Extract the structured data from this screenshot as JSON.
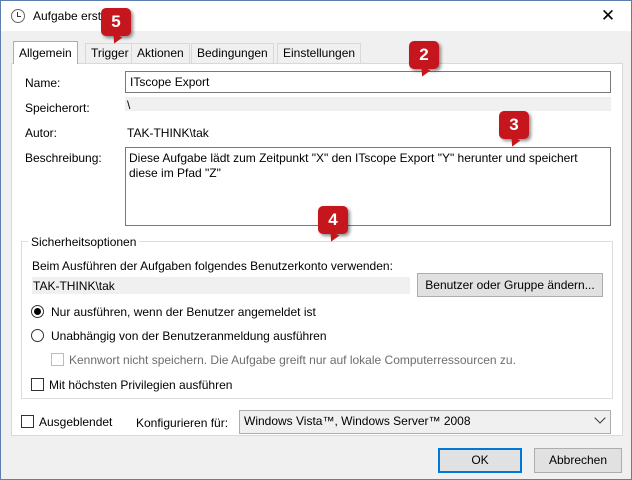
{
  "window": {
    "title": "Aufgabe erst",
    "close_glyph": "✕"
  },
  "tabs": [
    {
      "label": "Allgemein"
    },
    {
      "label": "Trigger"
    },
    {
      "label": "Aktionen"
    },
    {
      "label": "Bedingungen"
    },
    {
      "label": "Einstellungen"
    }
  ],
  "general": {
    "name_label": "Name:",
    "name_value": "ITscope Export",
    "location_label": "Speicherort:",
    "location_value": "\\",
    "author_label": "Autor:",
    "author_value": "TAK-THINK\\tak",
    "description_label": "Beschreibung:",
    "description_value": "Diese Aufgabe lädt zum Zeitpunkt \"X\" den ITscope Export \"Y\" herunter und speichert diese im Pfad \"Z\""
  },
  "security": {
    "group_title": "Sicherheitsoptionen",
    "account_prompt": "Beim Ausführen der Aufgaben folgendes Benutzerkonto verwenden:",
    "account_value": "TAK-THINK\\tak",
    "change_user_button": "Benutzer oder Gruppe ändern...",
    "radio_logged_on": "Nur ausführen, wenn der Benutzer angemeldet ist",
    "radio_logged_on_checked": true,
    "radio_independent": "Unabhängig von der Benutzeranmeldung ausführen",
    "radio_independent_checked": false,
    "no_password_label": "Kennwort nicht speichern. Die Aufgabe greift nur auf lokale Computerressourcen zu.",
    "no_password_checked": false,
    "highest_priv_label": "Mit höchsten Privilegien ausführen",
    "highest_priv_checked": false
  },
  "footer": {
    "hidden_label": "Ausgeblendet",
    "hidden_checked": false,
    "configure_label": "Konfigurieren für:",
    "configure_value": "Windows Vista™, Windows Server™ 2008",
    "ok_button": "OK",
    "cancel_button": "Abbrechen"
  },
  "callouts": [
    "5",
    "2",
    "3",
    "4"
  ],
  "colors": {
    "callout": "#c4161c",
    "default_button_border": "#0078d7"
  },
  "icons": {
    "window": "clock-icon",
    "close": "close-icon",
    "dropdown": "chevron-down-icon"
  }
}
